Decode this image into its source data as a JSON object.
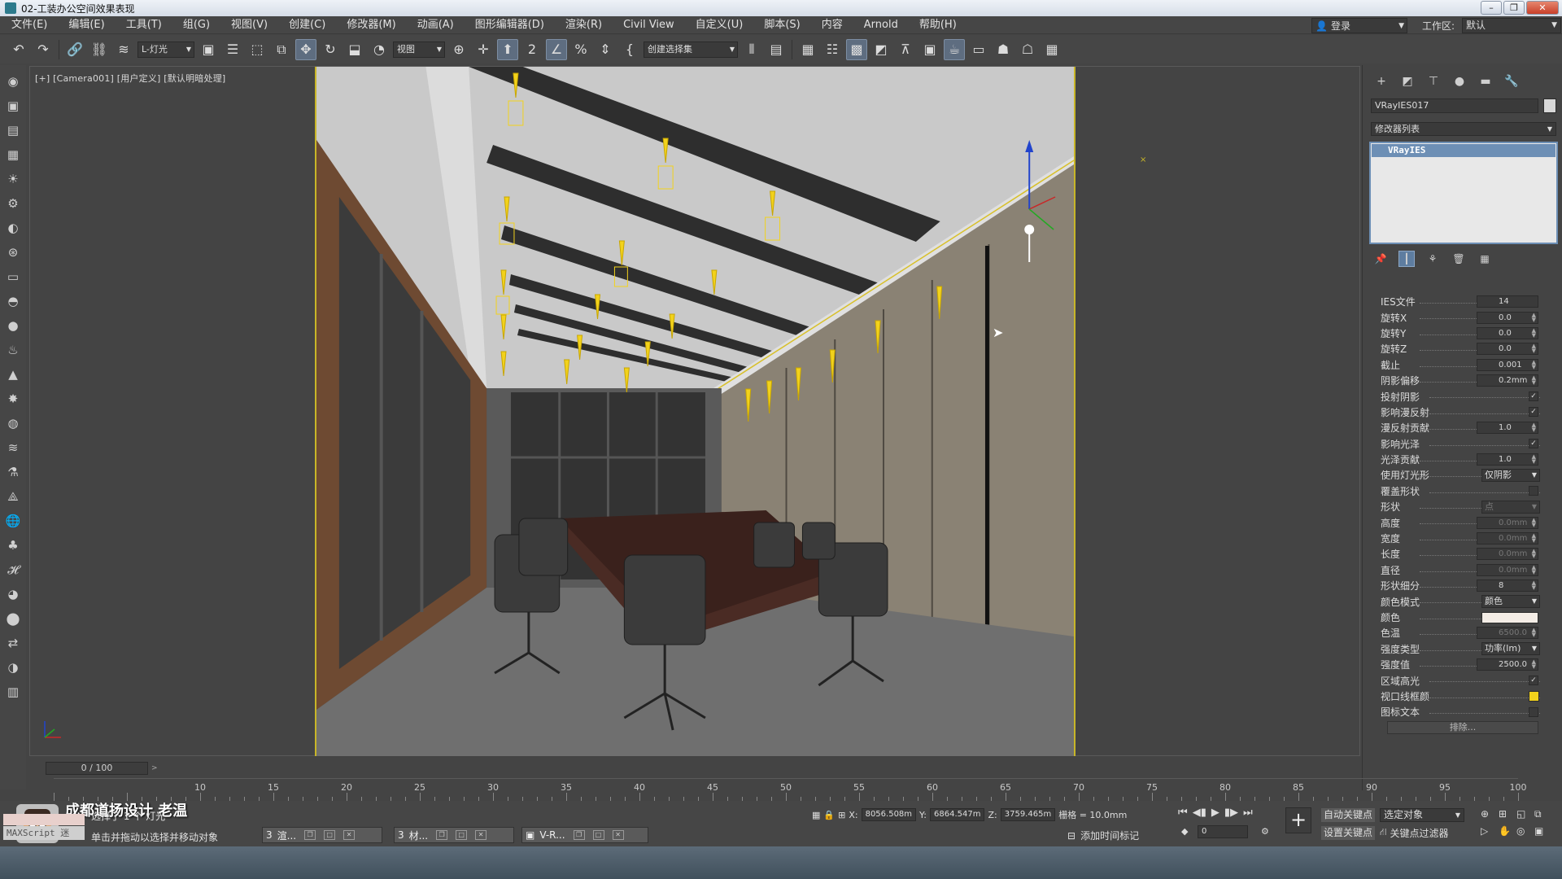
{
  "title_bar": {
    "title": "02-工装办公空间效果表现"
  },
  "menu": {
    "items": [
      "文件(E)",
      "编辑(E)",
      "工具(T)",
      "组(G)",
      "视图(V)",
      "创建(C)",
      "修改器(M)",
      "动画(A)",
      "图形编辑器(D)",
      "渲染(R)",
      "Civil View",
      "自定义(U)",
      "脚本(S)",
      "内容",
      "Arnold",
      "帮助(H)"
    ],
    "login": "登录",
    "workspace_label": "工作区:",
    "workspace_value": "默认"
  },
  "toolbar": {
    "filter": "L-灯光",
    "view": "视图",
    "selection_set": "创建选择集",
    "snap_label": "2",
    "percent": "%"
  },
  "viewport": {
    "label": "[+] [Camera001] [用户定义] [默认明暗处理]"
  },
  "command_panel": {
    "object_name": "VRayIES017",
    "modifier_list": "修改器列表",
    "stack_item": "VRayIES",
    "params": [
      {
        "label": "IES文件",
        "type": "button",
        "value": "14"
      },
      {
        "label": "旋转X",
        "type": "spinner",
        "value": "0.0"
      },
      {
        "label": "旋转Y",
        "type": "spinner",
        "value": "0.0"
      },
      {
        "label": "旋转Z",
        "type": "spinner",
        "value": "0.0"
      },
      {
        "label": "截止",
        "type": "spinner",
        "value": "0.001"
      },
      {
        "label": "阴影偏移",
        "type": "spinner",
        "value": "0.2mm"
      },
      {
        "label": "投射阴影",
        "type": "check",
        "value": "✓"
      },
      {
        "label": "影响漫反射",
        "type": "check",
        "value": "✓"
      },
      {
        "label": "漫反射贡献",
        "type": "spinner",
        "value": "1.0"
      },
      {
        "label": "影响光泽",
        "type": "check",
        "value": "✓"
      },
      {
        "label": "光泽贡献",
        "type": "spinner",
        "value": "1.0"
      },
      {
        "label": "使用灯光形状",
        "type": "dropdown",
        "value": "仅阴影"
      },
      {
        "label": "覆盖形状",
        "type": "check",
        "value": ""
      },
      {
        "label": "形状",
        "type": "dropdown-disabled",
        "value": "点"
      },
      {
        "label": "高度",
        "type": "spinner-disabled",
        "value": "0.0mm"
      },
      {
        "label": "宽度",
        "type": "spinner-disabled",
        "value": "0.0mm"
      },
      {
        "label": "长度",
        "type": "spinner-disabled",
        "value": "0.0mm"
      },
      {
        "label": "直径",
        "type": "spinner-disabled",
        "value": "0.0mm"
      },
      {
        "label": "形状细分",
        "type": "spinner",
        "value": "8"
      },
      {
        "label": "颜色模式",
        "type": "dropdown",
        "value": "颜色"
      },
      {
        "label": "颜色",
        "type": "color",
        "value": ""
      },
      {
        "label": "色温",
        "type": "spinner-disabled",
        "value": "6500.0"
      },
      {
        "label": "强度类型",
        "type": "dropdown",
        "value": "功率(lm)"
      },
      {
        "label": "强度值",
        "type": "spinner",
        "value": "2500.0"
      },
      {
        "label": "区域高光",
        "type": "check",
        "value": "✓"
      },
      {
        "label": "视口线框颜色",
        "type": "ycolor",
        "value": ""
      },
      {
        "label": "图标文本",
        "type": "check",
        "value": ""
      },
      {
        "label": "排除...",
        "type": "remove",
        "value": ""
      }
    ]
  },
  "timeline": {
    "current": "0 / 100",
    "ticks": [
      "10",
      "15",
      "20",
      "25",
      "30",
      "35",
      "40",
      "45",
      "50",
      "55",
      "60",
      "65",
      "70",
      "75",
      "80",
      "85",
      "90",
      "95",
      "100"
    ]
  },
  "status": {
    "watermark": "成都道扬设计 老温",
    "maxscript": "MAXScript 迷",
    "selected": "选择了 1 个 灯光",
    "hint": "单击并拖动以选择并移动对象",
    "x": "8056.508m",
    "y": "6864.547m",
    "z": "3759.465m",
    "grid": "栅格 = 10.0mm",
    "add_time_tag": "添加时间标记",
    "frame": "0",
    "auto_key": "自动关键点",
    "set_key": "设置关键点",
    "selected_object": "选定对象",
    "key_filters": "关键点过滤器"
  },
  "taskbar": [
    {
      "label": "渲..."
    },
    {
      "label": "材..."
    },
    {
      "label": "V-R..."
    }
  ],
  "colors": {
    "ui_bg": "#444444",
    "accent": "#6d8fb5",
    "safe_frame": "#c8b628",
    "light_yellow": "#f2d21c"
  }
}
